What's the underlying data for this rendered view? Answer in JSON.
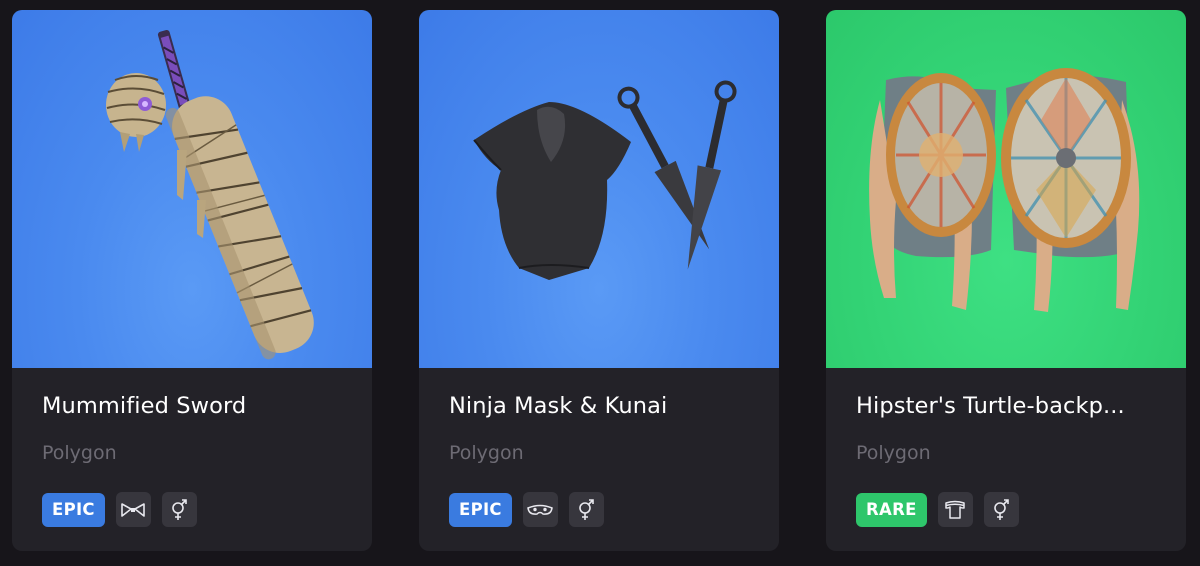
{
  "colors": {
    "page_bg": "#17151a",
    "card_bg": "#232228",
    "epic": "#3a7be0",
    "rare": "#2ec66b",
    "preview_blue": "#4a8aef",
    "preview_green": "#33d375",
    "creator_text": "#6d6b74"
  },
  "cards": [
    {
      "title": "Mummified Sword",
      "creator": "Polygon",
      "rarity": "EPIC",
      "rarity_color": "#3a7be0",
      "preview_bg": "blue",
      "slot_icon": "bowtie-icon",
      "gender_icon": "unisex-icon"
    },
    {
      "title": "Ninja Mask & Kunai",
      "creator": "Polygon",
      "rarity": "EPIC",
      "rarity_color": "#3a7be0",
      "preview_bg": "blue",
      "slot_icon": "mask-icon",
      "gender_icon": "unisex-icon"
    },
    {
      "title": "Hipster's Turtle-backp...",
      "creator": "Polygon",
      "rarity": "RARE",
      "rarity_color": "#2ec66b",
      "preview_bg": "green",
      "slot_icon": "shirt-icon",
      "gender_icon": "unisex-icon"
    }
  ]
}
